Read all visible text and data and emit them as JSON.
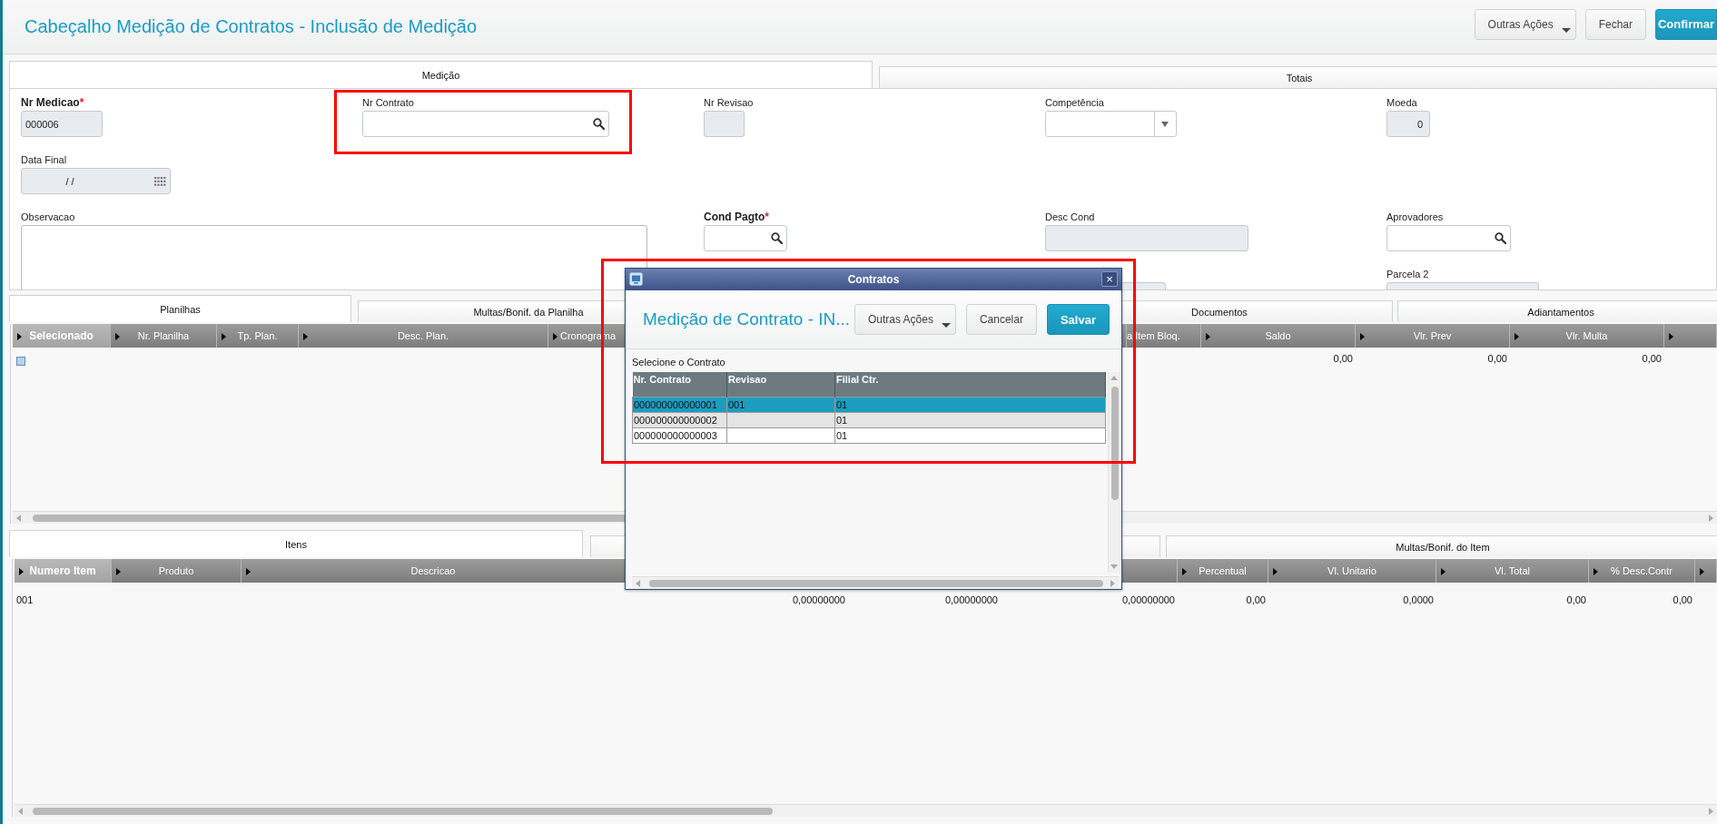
{
  "header": {
    "title": "Cabeçalho Medição de Contratos - Inclusão de Medição",
    "buttons": [
      {
        "label": "Outras Ações",
        "kind": "menu"
      },
      {
        "label": "Fechar",
        "kind": "default"
      },
      {
        "label": "Confirmar",
        "kind": "primary"
      }
    ]
  },
  "form_tabs": [
    {
      "label": "Medição",
      "selected": true
    },
    {
      "label": "Totais",
      "selected": false
    }
  ],
  "form": {
    "rows": [
      [
        {
          "label": "Nr Medicao",
          "required_mark": "*",
          "kind": "text",
          "value": "000006",
          "disabled": true,
          "highlighted": false
        },
        {
          "label": "Nr Contrato",
          "kind": "lookup",
          "disabled": false,
          "highlighted": true
        },
        {
          "label": "Nr Revisao",
          "kind": "text",
          "disabled": true,
          "highlighted": false
        },
        {
          "label": "Competência",
          "kind": "select",
          "disabled": false,
          "highlighted": false
        },
        {
          "label": "Moeda",
          "kind": "number",
          "value": "0",
          "disabled": true,
          "highlighted": false
        }
      ],
      [
        {
          "label": "Data Final",
          "kind": "date",
          "value": "/ /",
          "disabled": true,
          "highlighted": false
        },
        null,
        null,
        null,
        null
      ],
      [
        {
          "label": "Observacao",
          "kind": "memo",
          "disabled": false,
          "highlighted": false
        },
        null,
        {
          "label": "Cond Pagto",
          "required_mark": "*",
          "kind": "lookup",
          "disabled": false,
          "highlighted": false
        },
        {
          "label": "Desc Cond",
          "kind": "text",
          "disabled": true,
          "highlighted": false
        },
        {
          "label": "Aprovadores",
          "kind": "lookup",
          "disabled": false,
          "highlighted": false
        }
      ],
      [
        null,
        null,
        null,
        {
          "kind": "text",
          "disabled": true,
          "highlighted": false
        },
        {
          "label": "Parcela 2",
          "kind": "text",
          "disabled": true,
          "highlighted": false
        }
      ]
    ]
  },
  "panel_tabs": [
    {
      "label": "Planilhas",
      "selected": true
    },
    {
      "label": "Multas/Bonif. da Planilha",
      "selected": false
    },
    {
      "label": "Documentos",
      "selected": false
    },
    {
      "label": "Adiantamentos",
      "selected": false
    }
  ],
  "grid_planilhas": {
    "columns": [
      {
        "label": "Selecionado",
        "selected": true
      },
      {
        "label": "Nr. Planilha",
        "selected": false
      },
      {
        "label": "Tp. Plan.",
        "selected": false
      },
      {
        "label": "Desc. Plan.",
        "selected": false
      },
      {
        "label": "Cronograma",
        "selected": false
      },
      {
        "label": "a Item Bloq.",
        "selected": false
      },
      {
        "label": "Saldo",
        "selected": false
      },
      {
        "label": "Vlr. Prev",
        "selected": false
      },
      {
        "label": "Vlr. Multa",
        "selected": false
      }
    ],
    "rows": [
      {
        "checked": false,
        "cells": [
          null,
          null,
          null,
          null,
          null,
          null,
          null,
          "0,00",
          "0,00",
          "0,00"
        ]
      }
    ]
  },
  "item_tabs": [
    {
      "label": "Itens",
      "selected": true
    },
    {
      "selected": false
    },
    {
      "selected": false
    },
    {
      "label": "Multas/Bonif. do Item",
      "selected": false
    }
  ],
  "grid_itens": {
    "columns": [
      {
        "label": "Numero Item",
        "selected": true
      },
      {
        "label": "Produto",
        "selected": false
      },
      {
        "label": "Descricao",
        "selected": false
      },
      {
        "label": "Percentual",
        "selected": false
      },
      {
        "label": "Vl. Unitario",
        "selected": false
      },
      {
        "label": "Vl. Total",
        "selected": false
      },
      {
        "label": "% Desc.Contr",
        "selected": false
      }
    ],
    "rows": [
      {
        "cells": [
          "001",
          null,
          null,
          "0,00000000",
          "0,00000000",
          "0,00000000",
          "0,00",
          "0,0000",
          "0,00",
          "0,00"
        ]
      }
    ]
  },
  "dialog": {
    "title": "Contratos",
    "close_glyph": "×",
    "highlighted": true,
    "heading": "Medição de Contrato - IN...",
    "buttons": [
      {
        "label": "Outras Ações",
        "kind": "menu"
      },
      {
        "label": "Cancelar",
        "kind": "default"
      },
      {
        "label": "Salvar",
        "kind": "primary"
      }
    ],
    "prompt": "Selecione o Contrato",
    "table": {
      "columns": [
        "Nr. Contrato",
        "Revisao",
        "Filial Ctr."
      ],
      "rows": [
        {
          "cells": [
            "000000000000001",
            "001",
            "01"
          ],
          "selected": true
        },
        {
          "cells": [
            "000000000000002",
            "",
            "01"
          ],
          "selected": false
        },
        {
          "cells": [
            "000000000000003",
            "",
            "01"
          ],
          "selected": false
        }
      ]
    }
  }
}
